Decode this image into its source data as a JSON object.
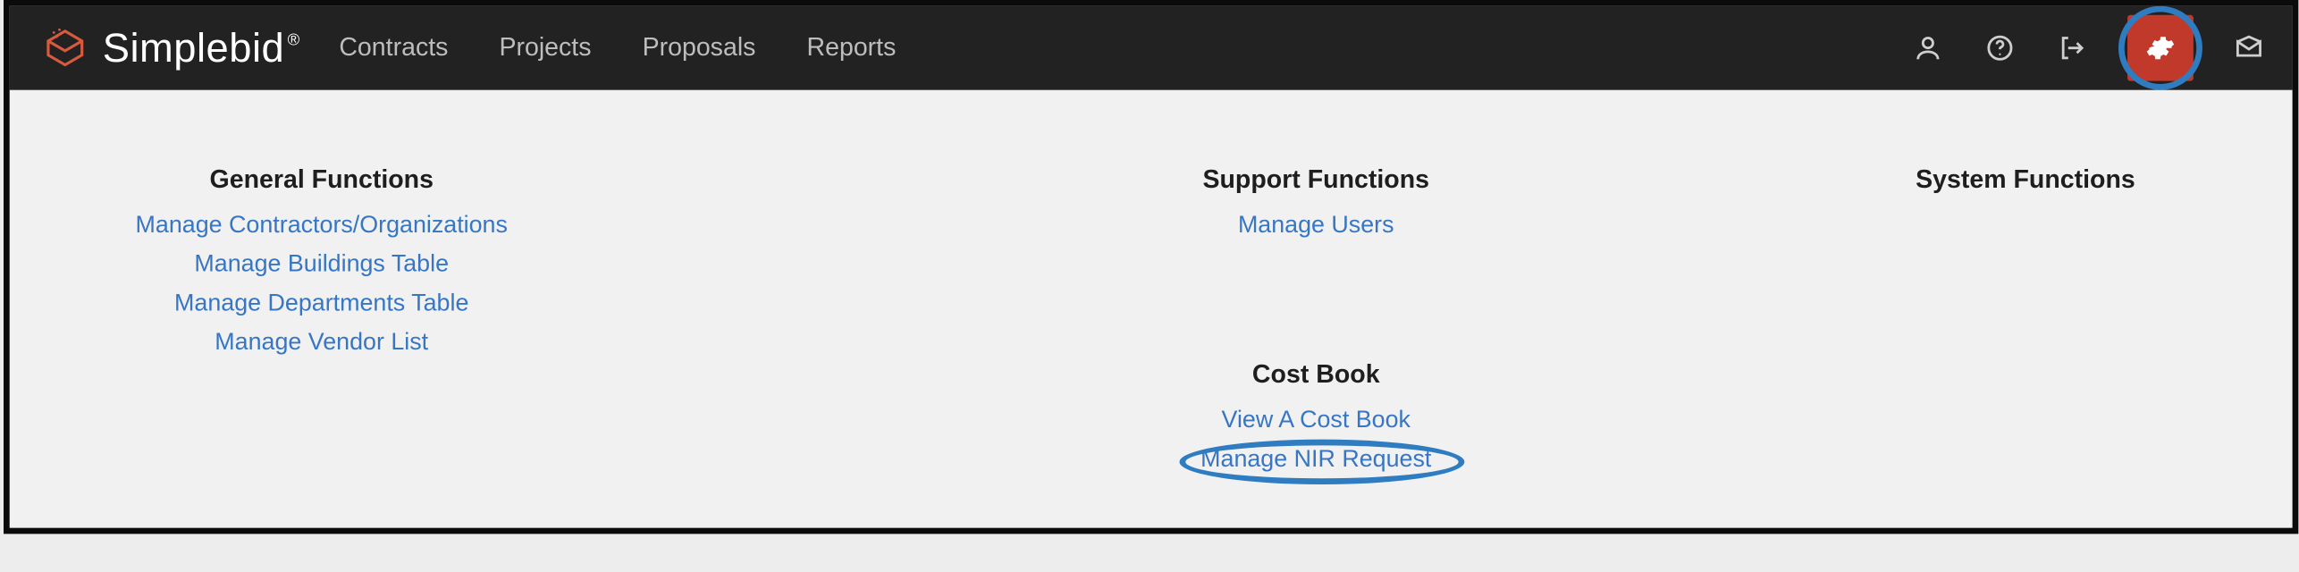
{
  "brand": {
    "name": "Simplebid",
    "mark": "®"
  },
  "nav": {
    "contracts": "Contracts",
    "projects": "Projects",
    "proposals": "Proposals",
    "reports": "Reports"
  },
  "columns": {
    "general": {
      "heading": "General Functions",
      "links": {
        "contractors": "Manage Contractors/Organizations",
        "buildings": "Manage Buildings Table",
        "departments": "Manage Departments Table",
        "vendors": "Manage Vendor List"
      }
    },
    "support": {
      "heading": "Support Functions",
      "links": {
        "users": "Manage Users"
      }
    },
    "costbook": {
      "heading": "Cost Book",
      "links": {
        "view": "View A Cost Book",
        "nir": "Manage NIR Request"
      }
    },
    "system": {
      "heading": "System Functions"
    }
  }
}
